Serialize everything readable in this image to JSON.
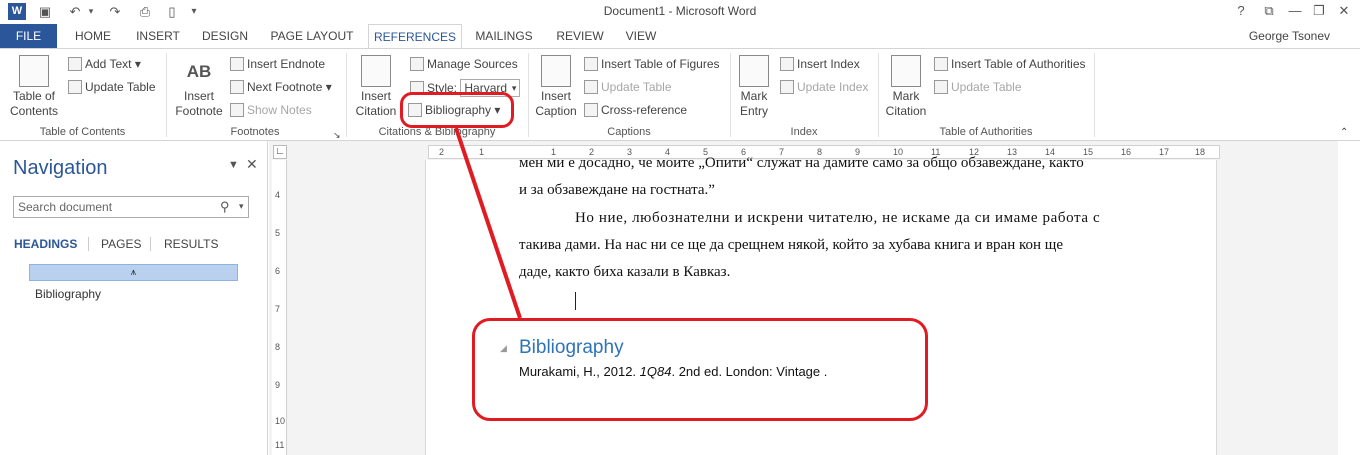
{
  "window": {
    "title": "Document1 - Microsoft Word",
    "user": "George Tsonev"
  },
  "quick_access": {
    "icons": [
      "word-icon",
      "save-icon",
      "undo-icon",
      "redo-icon",
      "print-preview-icon",
      "new-doc-icon"
    ]
  },
  "tabs": {
    "file": "FILE",
    "items": [
      "HOME",
      "INSERT",
      "DESIGN",
      "PAGE LAYOUT",
      "REFERENCES",
      "MAILINGS",
      "REVIEW",
      "VIEW"
    ],
    "active": "REFERENCES"
  },
  "ribbon": {
    "toc": {
      "big": "Table of\nContents",
      "add_text": "Add Text",
      "update_table": "Update Table",
      "label": "Table of Contents"
    },
    "footnotes": {
      "insert_footnote": "Insert\nFootnote",
      "insert_endnote": "Insert Endnote",
      "next_footnote": "Next Footnote",
      "show_notes": "Show Notes",
      "label": "Footnotes",
      "ab_glyph": "AB"
    },
    "citations": {
      "insert_citation": "Insert\nCitation",
      "manage_sources": "Manage Sources",
      "style_label": "Style:",
      "style_value": "Harvard",
      "bibliography": "Bibliography",
      "label": "Citations & Bibliography"
    },
    "captions": {
      "insert_caption": "Insert\nCaption",
      "insert_tof": "Insert Table of Figures",
      "update_table": "Update Table",
      "cross_ref": "Cross-reference",
      "label": "Captions"
    },
    "index": {
      "mark_entry": "Mark\nEntry",
      "insert_index": "Insert Index",
      "update_index": "Update Index",
      "label": "Index"
    },
    "authorities": {
      "mark_citation": "Mark\nCitation",
      "insert_toa": "Insert Table of Authorities",
      "update_table": "Update Table",
      "label": "Table of Authorities"
    }
  },
  "nav": {
    "title": "Navigation",
    "search_placeholder": "Search document",
    "tabs": [
      "HEADINGS",
      "PAGES",
      "RESULTS"
    ],
    "heading_item": "Bibliography"
  },
  "ruler": {
    "h": [
      "2",
      "1",
      "1",
      "2",
      "3",
      "4",
      "5",
      "6",
      "7",
      "8",
      "9",
      "10",
      "11",
      "12",
      "13",
      "14",
      "15",
      "16",
      "17",
      "18"
    ],
    "v": [
      "4",
      "5",
      "6",
      "7",
      "8",
      "9",
      "10",
      "11"
    ]
  },
  "document": {
    "p1a": "мен ми е досадно, че моите „Опити“ служат на дамите само за общо обзавеждане, както",
    "p1b": "и за обзавеждане на гостната.”",
    "p2a": "Но ние, любознателни и искрени читателю, не искаме да си имаме работа с",
    "p2b": "такива дами. На нас ни се ще да срещнем някой, който за хубава книга и вран кон ще",
    "p2c": "даде, както биха казали в Кавказ.",
    "bib_heading": "Bibliography",
    "bib_entry_pre": "Murakami, H., 2012. ",
    "bib_entry_title": "1Q84",
    "bib_entry_post": ". 2nd ed. London: Vintage ."
  },
  "colors": {
    "accent": "#2b579a",
    "annotation": "#e11b22",
    "heading": "#2e74b5"
  }
}
